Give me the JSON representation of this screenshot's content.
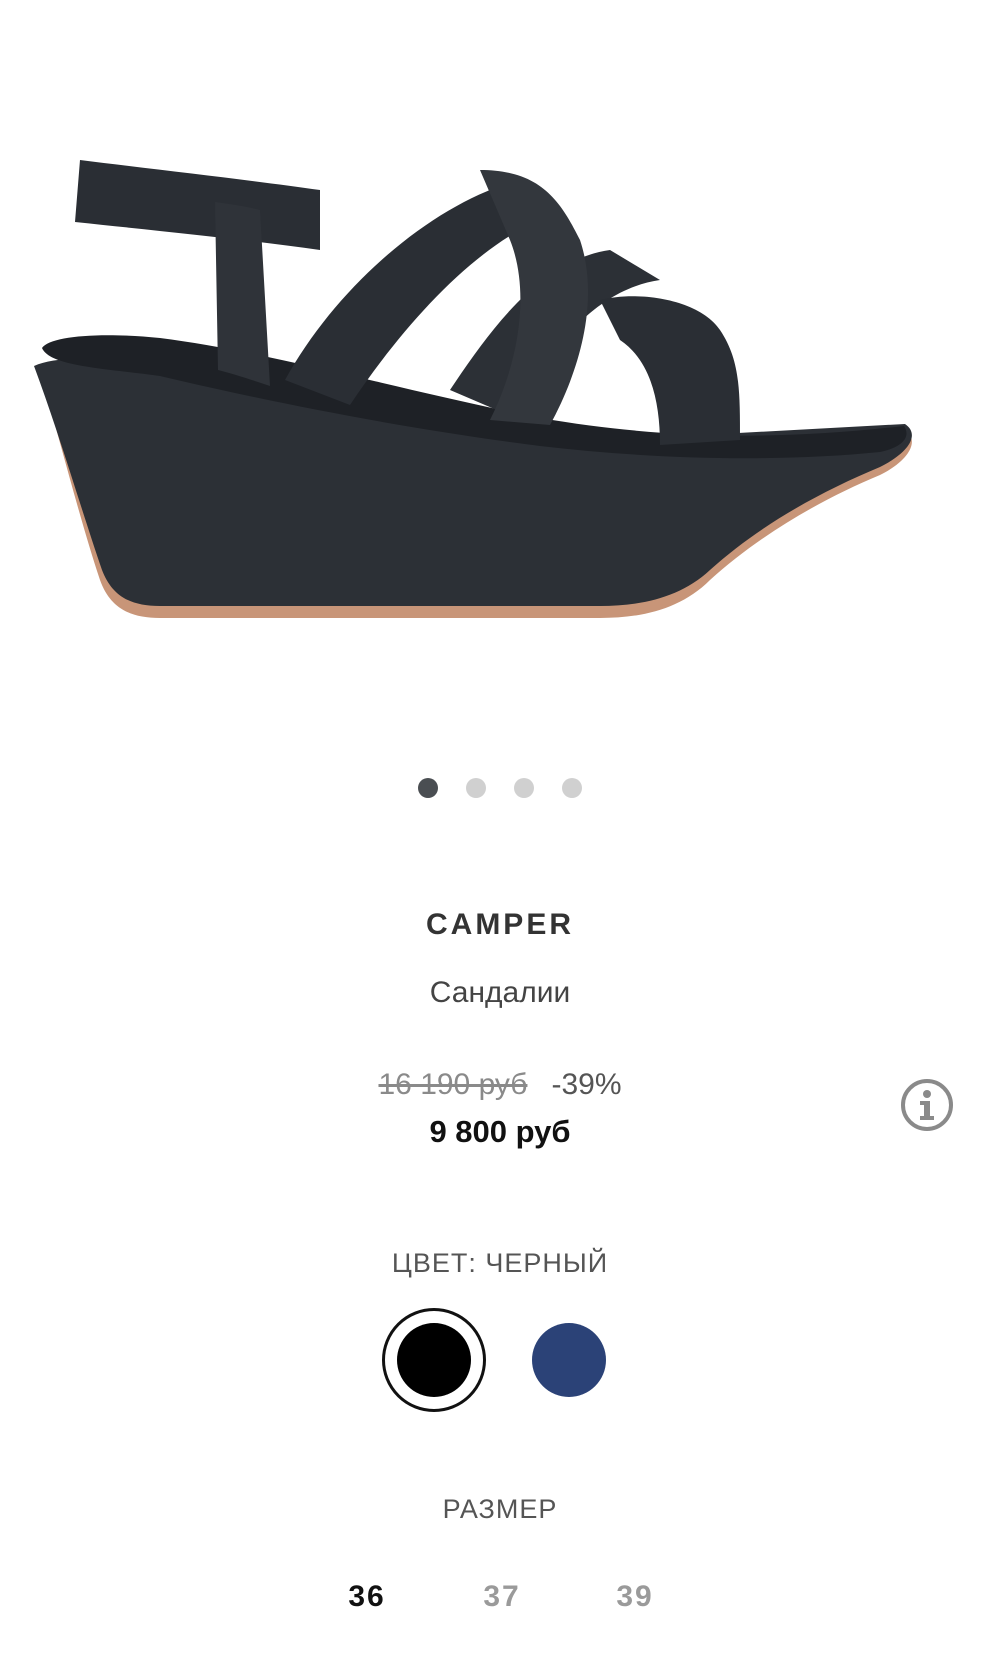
{
  "product_image": {
    "icon": "sandal-product-image"
  },
  "gallery": {
    "slides": 4,
    "active": 0
  },
  "product": {
    "brand": "CAMPER",
    "type": "Сандалии"
  },
  "price": {
    "old": "16 190 руб",
    "discount": "-39%",
    "current": "9 800 руб"
  },
  "info_button": {
    "icon": "info-icon"
  },
  "color": {
    "label": "ЦВЕТ: ЧЕРНЫЙ",
    "swatches": [
      {
        "name": "black",
        "hex": "#000000",
        "selected": true
      },
      {
        "name": "blue",
        "hex": "#2b4277",
        "selected": false
      }
    ]
  },
  "size": {
    "label": "РАЗМЕР",
    "options": [
      "36",
      "37",
      "39"
    ],
    "selected": "36"
  }
}
